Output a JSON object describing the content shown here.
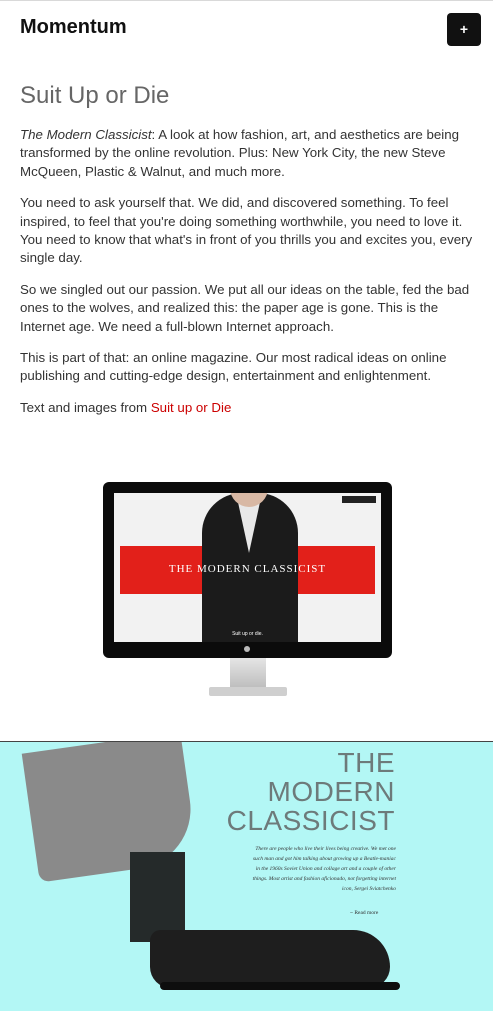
{
  "header": {
    "brand": "Momentum",
    "menu_label": "+"
  },
  "article": {
    "title": "Suit Up or Die",
    "intro_em": "The Modern Classicist",
    "intro_rest": ": A look at how fashion, art, and aesthetics are being transformed by the online revolution. Plus: New York City, the new Steve McQueen, Plastic & Walnut, and much more.",
    "paragraphs": [
      "You need to ask yourself that. We did, and discovered something. To feel inspired, to feel that you're doing something worthwhile, you need to love it. You need to know that what's in front of you thrills you and excites you, every single day.",
      "So we singled out our passion. We put all our ideas on the table, fed the bad ones to the wolves, and realized this: the paper age is gone. This is the Internet age. We need a full-blown Internet approach.",
      "This is part of that: an online magazine. Our most radical ideas on online publishing and cutting-edge design, entertainment and enlightenment."
    ],
    "credit_prefix": "Text and images from ",
    "credit_link": "Suit up or Die"
  },
  "screen_image": {
    "title": "THE MODERN CLASSICIST",
    "tagline": "Suit up or die."
  },
  "hero_image": {
    "title_lines": [
      "THE",
      "MODERN",
      "CLASSICIST"
    ],
    "blurb": "There are people who live their lives being creative. We met one such man and got him talking about growing up a Beatle-maniac in the 1960s Soviet Union and collage art and a couple of other things. Most artist and fashion aficionado, not forgetting internet icon, Sergei Sviatchenko",
    "read_more": "~ Read more"
  },
  "colors": {
    "accent_link": "#cc0000",
    "hero_bg": "#b3f7f5",
    "screen_red": "#e2201a"
  }
}
